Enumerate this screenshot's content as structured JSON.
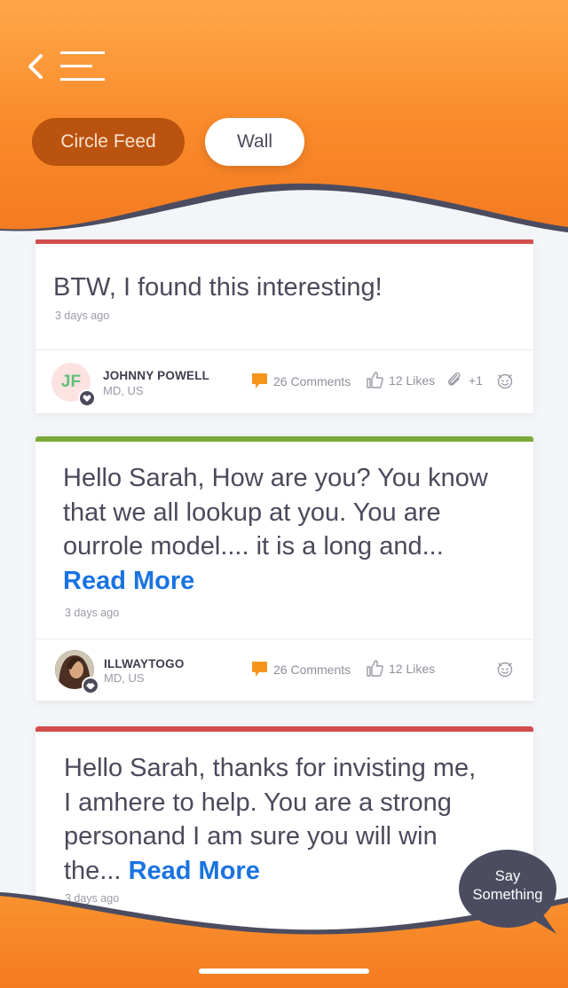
{
  "header": {
    "tabs": [
      {
        "label": "Circle Feed",
        "active": true
      },
      {
        "label": "Wall",
        "active": false
      }
    ]
  },
  "posts": [
    {
      "text": "BTW, I found this interesting!",
      "read_more": "",
      "time": "3 days ago",
      "accent_color": "#d24d4d",
      "author": {
        "name": "JOHNNY POWELL",
        "location": "MD, US",
        "initials": "JF",
        "badge": "heart-icon"
      },
      "comments": "26 Comments",
      "likes": "12 Likes",
      "attachments": "+1"
    },
    {
      "text": "Hello Sarah, How are you? You know that we all lookup at you. You are ourrole model.... it is a long and...",
      "read_more": "Read More",
      "time": "3 days ago",
      "accent_color": "#7aaa3a",
      "author": {
        "name": "ILLWAYTOGO",
        "location": "MD, US",
        "badge": "handshake-icon"
      },
      "comments": "26 Comments",
      "likes": "12 Likes"
    },
    {
      "text": "Hello Sarah, thanks for invisting me, I amhere to help. You are a strong personand I am sure you will win the...",
      "read_more": "Read More",
      "time": "3 days ago",
      "accent_color": "#d24d4d"
    }
  ],
  "fab": {
    "line1": "Say",
    "line2": "Something"
  },
  "colors": {
    "accent": "#f98a2a",
    "dark": "#4a4a5a",
    "link": "#1a73e0"
  }
}
